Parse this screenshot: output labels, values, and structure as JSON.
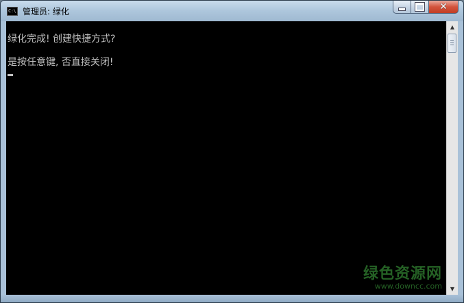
{
  "window": {
    "title": "管理员: 绿化",
    "icon": "console-icon",
    "icon_text": "C:\\",
    "controls": {
      "minimize_icon": "minimize-icon",
      "maximize_icon": "maximize-icon",
      "close_icon": "close-icon",
      "close_glyph": "✕"
    }
  },
  "console": {
    "lines": [
      "绿化完成! 创建快捷方式?",
      "是按任意键, 否直接关闭!"
    ],
    "text_color": "#c0c0c0",
    "background": "#000000"
  },
  "scrollbar": {
    "up_arrow": "▲",
    "down_arrow": "▼"
  },
  "watermark": {
    "main": "绿色资源网",
    "sub": "www.downcc.com"
  }
}
